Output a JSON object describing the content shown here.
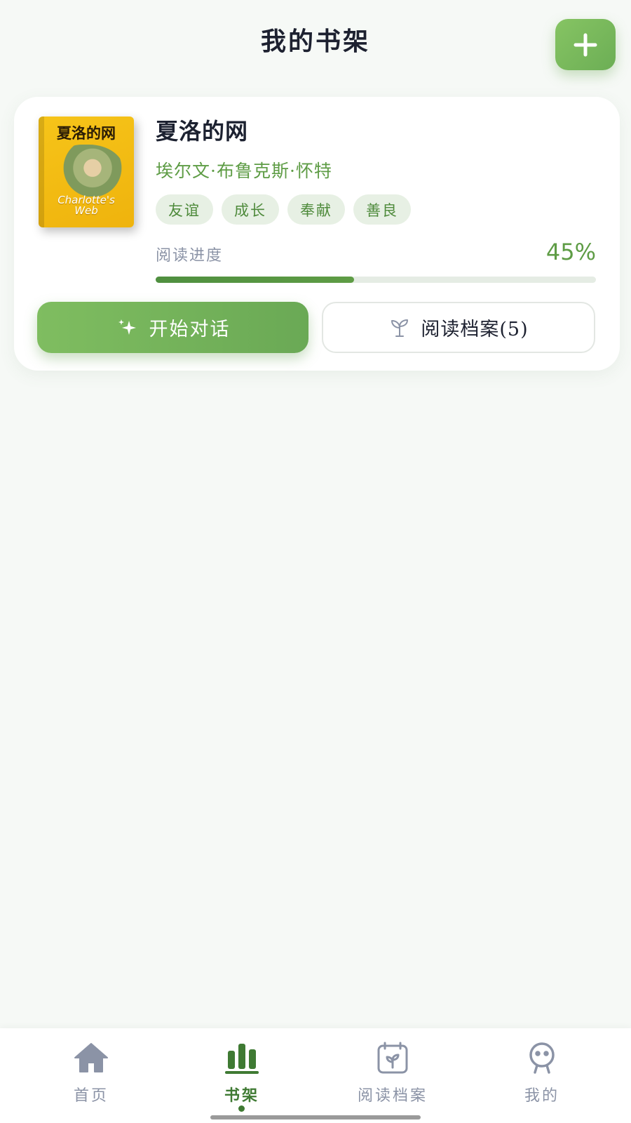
{
  "header": {
    "title": "我的书架"
  },
  "book": {
    "cover": {
      "title_cn": "夏洛的网",
      "title_en_line1": "Charlotte's",
      "title_en_line2": "Web"
    },
    "title": "夏洛的网",
    "author": "埃尔文·布鲁克斯·怀特",
    "tags": [
      "友谊",
      "成长",
      "奉献",
      "善良"
    ],
    "progress_label": "阅读进度",
    "progress_text": "45%",
    "progress_fraction": 0.45,
    "chat_button_label": "开始对话",
    "archive_button_label": "阅读档案(5)"
  },
  "nav": {
    "items": [
      {
        "label": "首页",
        "icon": "home-icon",
        "active": false
      },
      {
        "label": "书架",
        "icon": "bookshelf-icon",
        "active": true
      },
      {
        "label": "阅读档案",
        "icon": "calendar-sprout-icon",
        "active": false
      },
      {
        "label": "我的",
        "icon": "profile-icon",
        "active": false
      }
    ]
  },
  "colors": {
    "accent": "#6cae55",
    "accent_dark": "#3f7a33",
    "muted": "#8b93a6",
    "background": "#f6f9f6"
  }
}
